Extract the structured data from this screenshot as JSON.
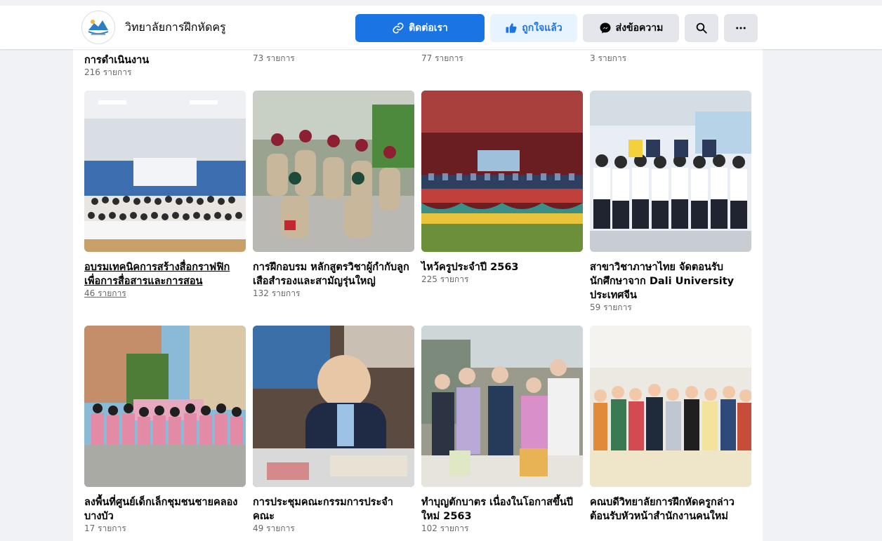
{
  "header": {
    "page_name": "วิทยาลัยการฝึกหัดครู",
    "contact_label": "ติดต่อเรา",
    "liked_label": "ถูกใจแล้ว",
    "message_label": "ส่งข้อความ",
    "colors": {
      "primary": "#1b74e4",
      "liked_bg": "#e7f3ff",
      "secondary_bg": "#e4e6eb"
    },
    "icons": [
      "link-icon",
      "thumbs-up-icon",
      "messenger-icon",
      "search-icon",
      "more-icon"
    ]
  },
  "top_row": [
    {
      "title": "การดำเนินงาน",
      "count": "216 รายการ"
    },
    {
      "title": "",
      "count": "73 รายการ"
    },
    {
      "title": "",
      "count": "77 รายการ"
    },
    {
      "title": "",
      "count": "3 รายการ"
    }
  ],
  "albums": [
    {
      "title": "อบรมเทคนิคการสร้างสื่อกราฟฟิกเพื่อการสื่อสารและการสอน",
      "count": "46 รายการ"
    },
    {
      "title": "การฝึกอบรม หลักสูตรวิชาผู้กำกับลูกเสือสำรองและสามัญรุ่นใหญ่",
      "count": "132 รายการ"
    },
    {
      "title": "ไหว้ครูประจำปี 2563",
      "count": "225 รายการ"
    },
    {
      "title": "สาขาวิชาภาษาไทย จัดตอนรับนักศึกษาจาก Dali University ประเทศจีน",
      "count": "59 รายการ"
    },
    {
      "title": "ลงพื้นที่ศูนย์เด็กเล็กชุมชนชายคลองบางบัว",
      "count": "17 รายการ"
    },
    {
      "title": "การประชุมคณะกรรมการประจำคณะ",
      "count": "49 รายการ"
    },
    {
      "title": "ทำบุญตักบาตร เนื่องในโอกาสขึ้นปีใหม่ 2563",
      "count": "102 รายการ"
    },
    {
      "title": "คณบดีวิทยาลัยการฝึกหัดครูกล่าวต้อนรับหัวหน้าสำนักงานคนใหม่",
      "count": ""
    }
  ]
}
